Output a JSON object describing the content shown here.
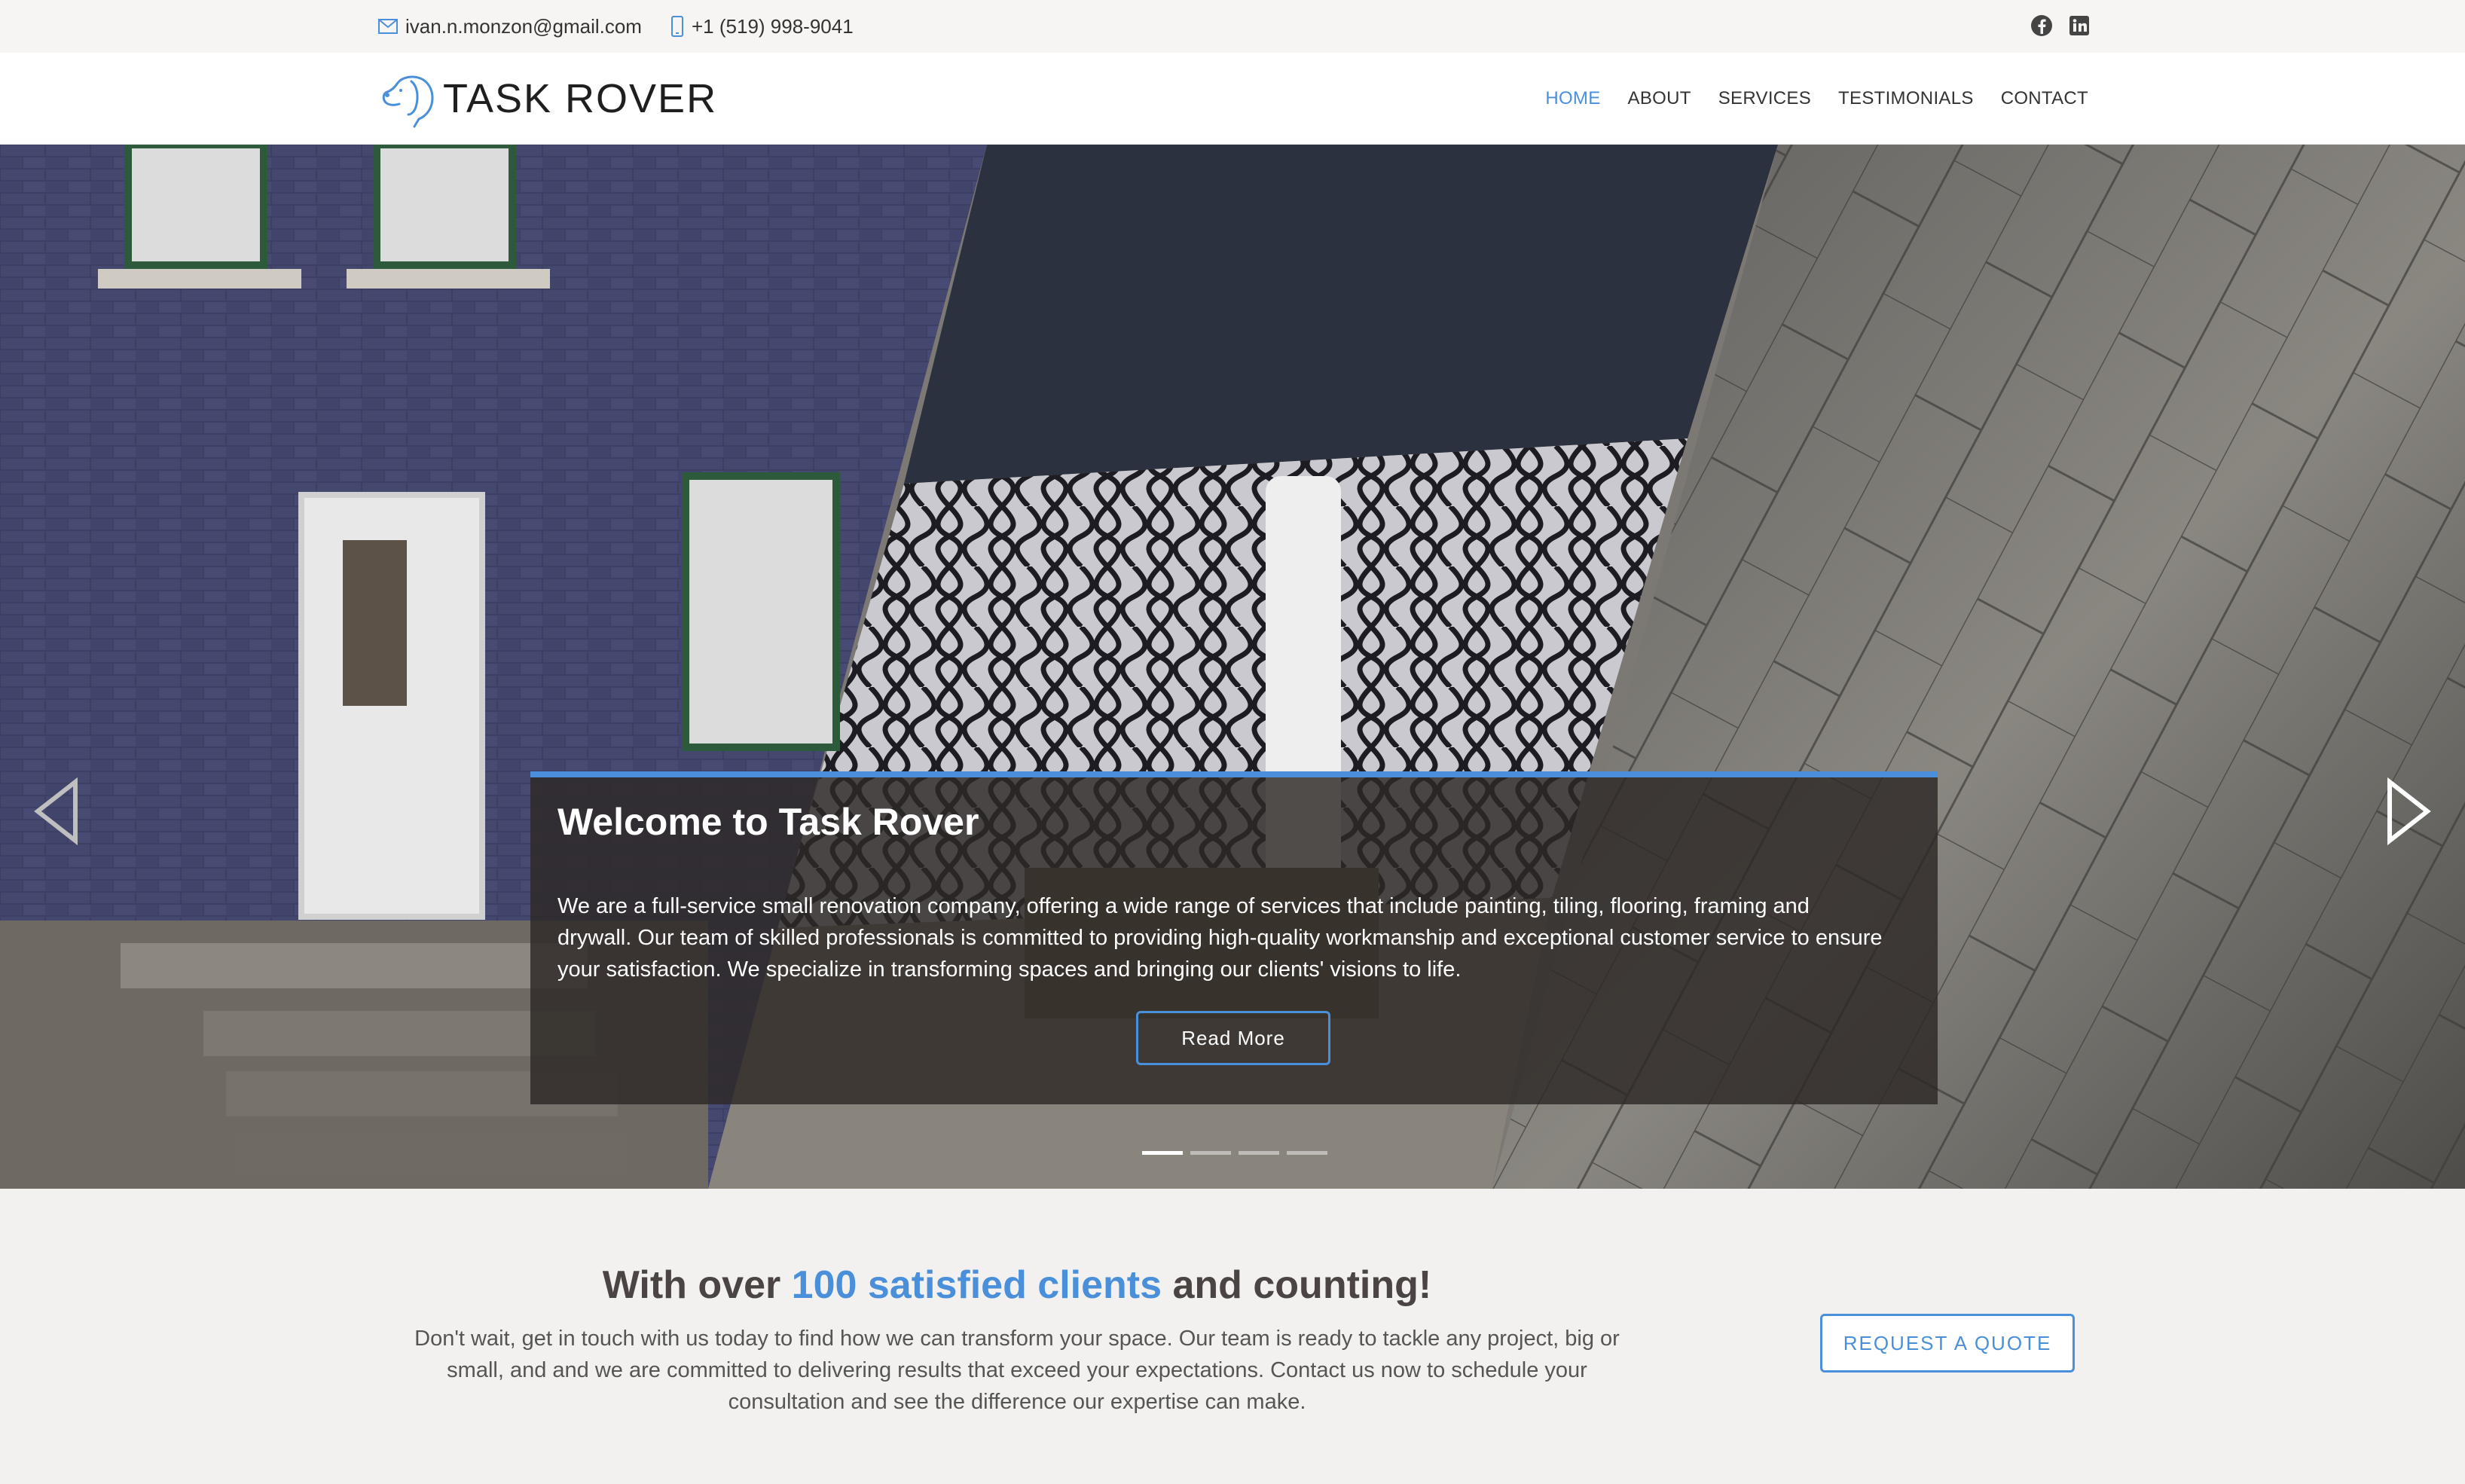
{
  "topbar": {
    "email": "ivan.n.monzon@gmail.com",
    "phone": "+1 (519) 998-9041",
    "social": [
      "facebook-icon",
      "linkedin-icon"
    ]
  },
  "header": {
    "logo_text": "TASK ROVER",
    "nav": [
      {
        "label": "HOME",
        "active": true
      },
      {
        "label": "ABOUT"
      },
      {
        "label": "SERVICES"
      },
      {
        "label": "TESTIMONIALS"
      },
      {
        "label": "CONTACT"
      }
    ]
  },
  "hero": {
    "title": "Welcome to Task Rover",
    "text": "We are a full-service small renovation company, offering a wide range of services that include painting, tiling, flooring, framing and drywall. Our team of skilled professionals is committed to providing high-quality workmanship and exceptional customer service to ensure your satisfaction. We specialize in transforming spaces and bringing our clients' visions to life.",
    "button": "Read More",
    "slides": 4,
    "active_slide": 1
  },
  "cta": {
    "heading_before": "With over ",
    "heading_highlight": "100 satisfied clients",
    "heading_after": " and counting!",
    "text": "Don't wait, get in touch with us today to find how we can transform your space. Our team is ready to tackle any project, big or small, and and we are committed to delivering results that exceed your expectations. Contact us now to schedule your consultation and see the difference our expertise can make.",
    "button": "REQUEST A QUOTE"
  },
  "colors": {
    "accent": "#4a8fd9",
    "dark_text": "#4a4442",
    "caption_bg": "#2d2826"
  }
}
